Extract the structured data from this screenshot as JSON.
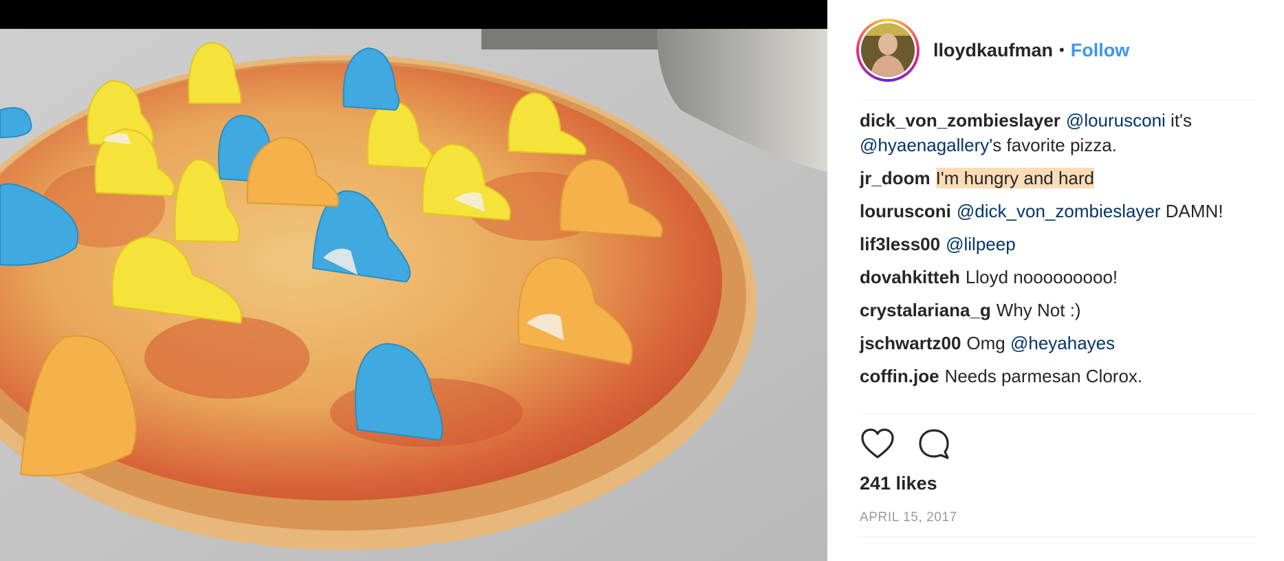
{
  "post": {
    "author": "lloydkaufman",
    "separator": "•",
    "follow_label": "Follow",
    "likes": "241 likes",
    "date": "APRIL 15, 2017"
  },
  "comments": [
    {
      "user": "dick_von_zombieslayer",
      "m1": "@lourusconi",
      "t1": " it's ",
      "m2": "@hyaenagallery",
      "t2": "'s favorite pizza."
    },
    {
      "user": "jr_doom",
      "hl": "I'm hungry and hard"
    },
    {
      "user": "lourusconi",
      "m1": "@dick_von_zombieslayer",
      "t1": " DAMN!"
    },
    {
      "user": "lif3less00",
      "m1": "@lilpeep"
    },
    {
      "user": "dovahkitteh",
      "t1": "Lloyd nooooooooo!"
    },
    {
      "user": "crystalariana_g",
      "t1": "Why Not :)"
    },
    {
      "user": "jschwartz00",
      "t1": "Omg ",
      "m1": "@heyahayes"
    },
    {
      "user": "coffin.joe",
      "t1": "Needs parmesan Clorox."
    }
  ],
  "icons": {
    "like": "heart-icon",
    "comment": "comment-bubble-icon"
  },
  "colors": {
    "follow": "#3897f0",
    "mention": "#003569",
    "highlight": "#fbdcb7",
    "text": "#262626",
    "muted": "#999999",
    "peep_yellow": "#f5e23a",
    "peep_blue": "#3fa9e0",
    "peep_orange": "#f5b14a"
  }
}
